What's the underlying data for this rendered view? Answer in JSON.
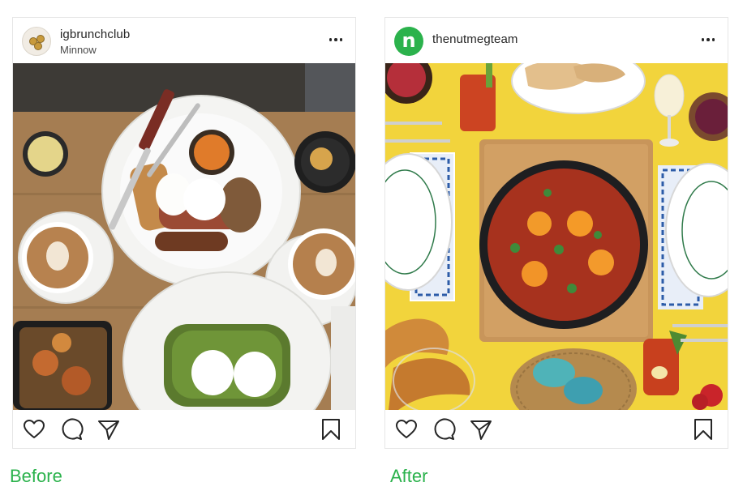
{
  "posts": [
    {
      "username": "igbrunchclub",
      "location": "Minnow",
      "label": "Before"
    },
    {
      "username": "thenutmegteam",
      "location": "",
      "label": "After"
    }
  ],
  "icons": {
    "like": "heart-icon",
    "comment": "comment-bubble-icon",
    "share": "paper-plane-icon",
    "save": "bookmark-icon",
    "more": "more-options-icon"
  },
  "colors": {
    "label_green": "#2bb24c",
    "nutmeg_avatar": "#2bb24c",
    "after_background": "#f1d23a",
    "before_table": "#a07a4e"
  }
}
